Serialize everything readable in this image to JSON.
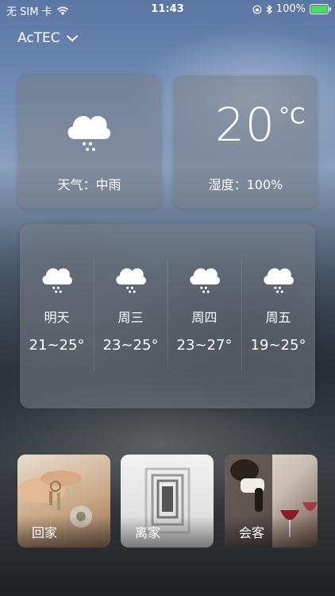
{
  "status_bar": {
    "carrier": "无 SIM 卡",
    "time": "11:43",
    "battery": "100%"
  },
  "location": {
    "name": "AcTEC"
  },
  "current": {
    "condition_label": "天气：中雨",
    "temperature": "20",
    "unit": "°C",
    "humidity_label": "湿度：100%",
    "icon": "cloud-snow-icon"
  },
  "forecast": [
    {
      "day": "明天",
      "range": "21~25°",
      "icon": "cloud-snow-icon"
    },
    {
      "day": "周三",
      "range": "23~25°",
      "icon": "cloud-snow-icon"
    },
    {
      "day": "周四",
      "range": "23~27°",
      "icon": "cloud-snow-icon"
    },
    {
      "day": "周五",
      "range": "19~25°",
      "icon": "cloud-snow-icon"
    }
  ],
  "scenes": [
    {
      "label": "回家"
    },
    {
      "label": "离家"
    },
    {
      "label": "会客"
    }
  ],
  "colors": {
    "battery": "#4cd964",
    "card": "#787d87"
  }
}
